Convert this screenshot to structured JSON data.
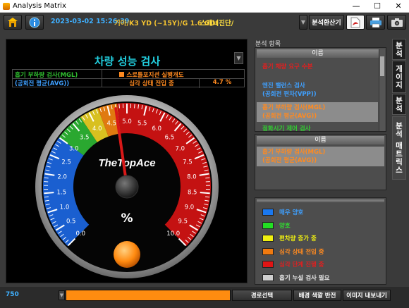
{
  "window": {
    "title": "Analysis Matrix"
  },
  "toolbar": {
    "datetime": "2023-03-02 15:26:39",
    "vehicle": "기아/K3 YD (~15Y)/G 1.6 GDI",
    "mode": "스캐너진단/",
    "analysis_button": "분석환산기"
  },
  "gauge": {
    "title": "차량 성능 검사",
    "info": {
      "row1_label": "흡기 부하량 검사(MGL)",
      "row1_status": "스로틀포지션 실행개도",
      "row2_label": "(공회전 평균(AVG))",
      "row2_status": "심각 상태 전입 중",
      "row2_value": "4.7 %"
    },
    "brand": "TheTopAce",
    "unit": "%",
    "value": 4.7,
    "min": 0,
    "max": 10,
    "ticks": [
      "0.0",
      "0.5",
      "1.0",
      "1.5",
      "2.0",
      "2.5",
      "3.0",
      "3.5",
      "4.0",
      "4.5",
      "5.0",
      "5.5",
      "6.0",
      "6.5",
      "7.0",
      "7.5",
      "8.0",
      "8.5",
      "9.0",
      "9.5",
      "10.0"
    ],
    "colors": {
      "blue": "#1a5fd0",
      "green": "#2aa830",
      "yellow": "#d8c020",
      "orange": "#e07a10",
      "red": "#c41212"
    }
  },
  "analysis": {
    "section_label": "분석 항목",
    "list1_header": "이름",
    "list1_items": [
      {
        "text": "흡기 체량 요구 수분",
        "color": "#e02020"
      },
      {
        "text": "엔진 밸런스 검사",
        "color": "#3fa0ff"
      },
      {
        "text": "(공회전 편차(VPP))",
        "color": "#3fa0ff"
      },
      {
        "text": "흡기 부하량 검사(MGL)",
        "color": "#ff8a20"
      },
      {
        "text": "(공회전 평균(AVG))",
        "color": "#ff8a20"
      },
      {
        "text": "점화시기 제어 검사",
        "color": "#30d030"
      }
    ],
    "list2_header": "이름",
    "list2_items": [
      {
        "text": "흡기 부하량 검사(MGL)",
        "color": "#ff8a20"
      },
      {
        "text": "(공회전 평균(AVG))",
        "color": "#ff8a20"
      }
    ]
  },
  "legend": [
    {
      "label": "매우 양호",
      "color": "#1a78f0",
      "text_color": "#3fa0ff"
    },
    {
      "label": "양호",
      "color": "#22e022",
      "text_color": "#30e030"
    },
    {
      "label": "편차량 증가 중",
      "color": "#f0f010",
      "text_color": "#f0f010"
    },
    {
      "label": "심각 상태 전입 중",
      "color": "#f07a10",
      "text_color": "#ff8a20"
    },
    {
      "label": "심각 단계 진행 중",
      "color": "#e01414",
      "text_color": "#e02020"
    },
    {
      "label": "흡기 누설 검사 필요",
      "color": "#cfcfcf",
      "text_color": "#e8e8e8"
    }
  ],
  "side_tabs": [
    "분석",
    "게이지",
    "분석",
    "분석 매트릭스"
  ],
  "bottom": {
    "value": "750",
    "progress": 1.0,
    "route_button": "경로선택",
    "bg_button": "배경 색깔 반전",
    "export_button": "이미지 내보내기"
  }
}
